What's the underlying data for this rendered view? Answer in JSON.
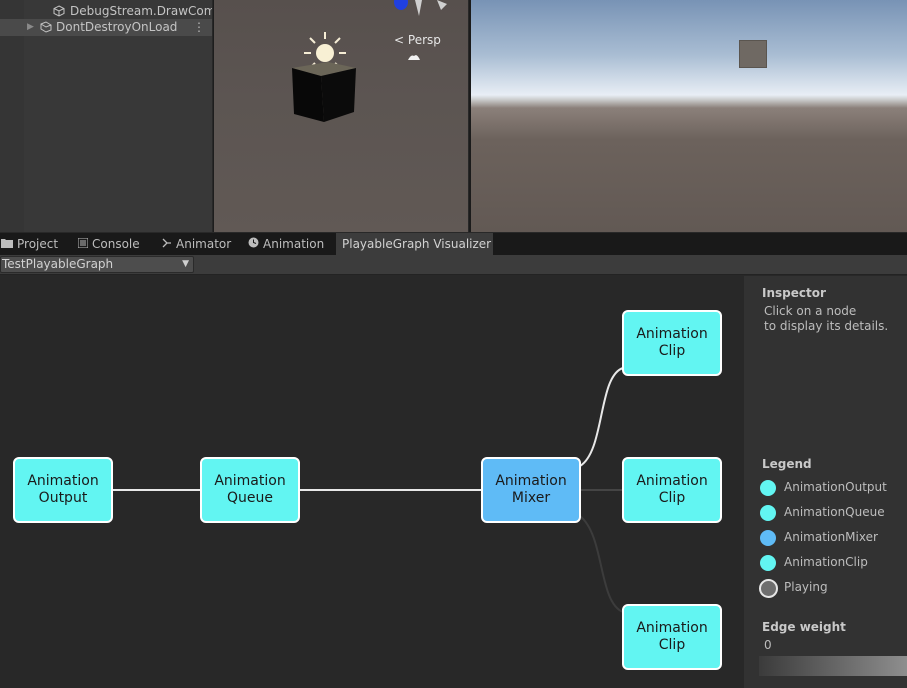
{
  "hierarchy": {
    "items": [
      {
        "label": "DebugStream.DrawComp"
      },
      {
        "label": "DontDestroyOnLoad"
      }
    ],
    "menu_glyph": "⋮"
  },
  "scene": {
    "persp_label": "Persp"
  },
  "tabs": [
    {
      "label": "Project",
      "icon": "folder-icon"
    },
    {
      "label": "Console",
      "icon": "console-icon"
    },
    {
      "label": "Animator",
      "icon": "animator-icon"
    },
    {
      "label": "Animation",
      "icon": "animation-icon"
    },
    {
      "label": "PlayableGraph Visualizer",
      "icon": ""
    }
  ],
  "toolbar": {
    "graph_selected": "TestPlayableGraph"
  },
  "graph": {
    "nodes": {
      "output": {
        "line1": "Animation",
        "line2": "Output",
        "type": "AnimationOutput"
      },
      "queue": {
        "line1": "Animation",
        "line2": "Queue",
        "type": "AnimationQueue"
      },
      "mixer": {
        "line1": "Animation",
        "line2": "Mixer",
        "type": "AnimationMixer"
      },
      "clip1": {
        "line1": "Animation",
        "line2": "Clip",
        "type": "AnimationClip"
      },
      "clip2": {
        "line1": "Animation",
        "line2": "Clip",
        "type": "AnimationClip"
      },
      "clip3": {
        "line1": "Animation",
        "line2": "Clip",
        "type": "AnimationClip"
      }
    }
  },
  "inspector": {
    "title": "Inspector",
    "hint_line1": "Click on a node",
    "hint_line2": "to display its details.",
    "legend_title": "Legend",
    "legend": [
      {
        "label": "AnimationOutput",
        "color": "#62f5f2"
      },
      {
        "label": "AnimationQueue",
        "color": "#62f5f2"
      },
      {
        "label": "AnimationMixer",
        "color": "#5fbbf6"
      },
      {
        "label": "AnimationClip",
        "color": "#62f5f2"
      },
      {
        "label": "Playing",
        "color": "#6e6e6e"
      }
    ],
    "edge_weight_title": "Edge weight",
    "edge_weight_value": "0"
  },
  "colors": {
    "node_cyan": "#62f5f2",
    "node_blue": "#5fbbf6",
    "edge_active": "#e8e8e8",
    "edge_inactive": "#3c3c3c"
  }
}
